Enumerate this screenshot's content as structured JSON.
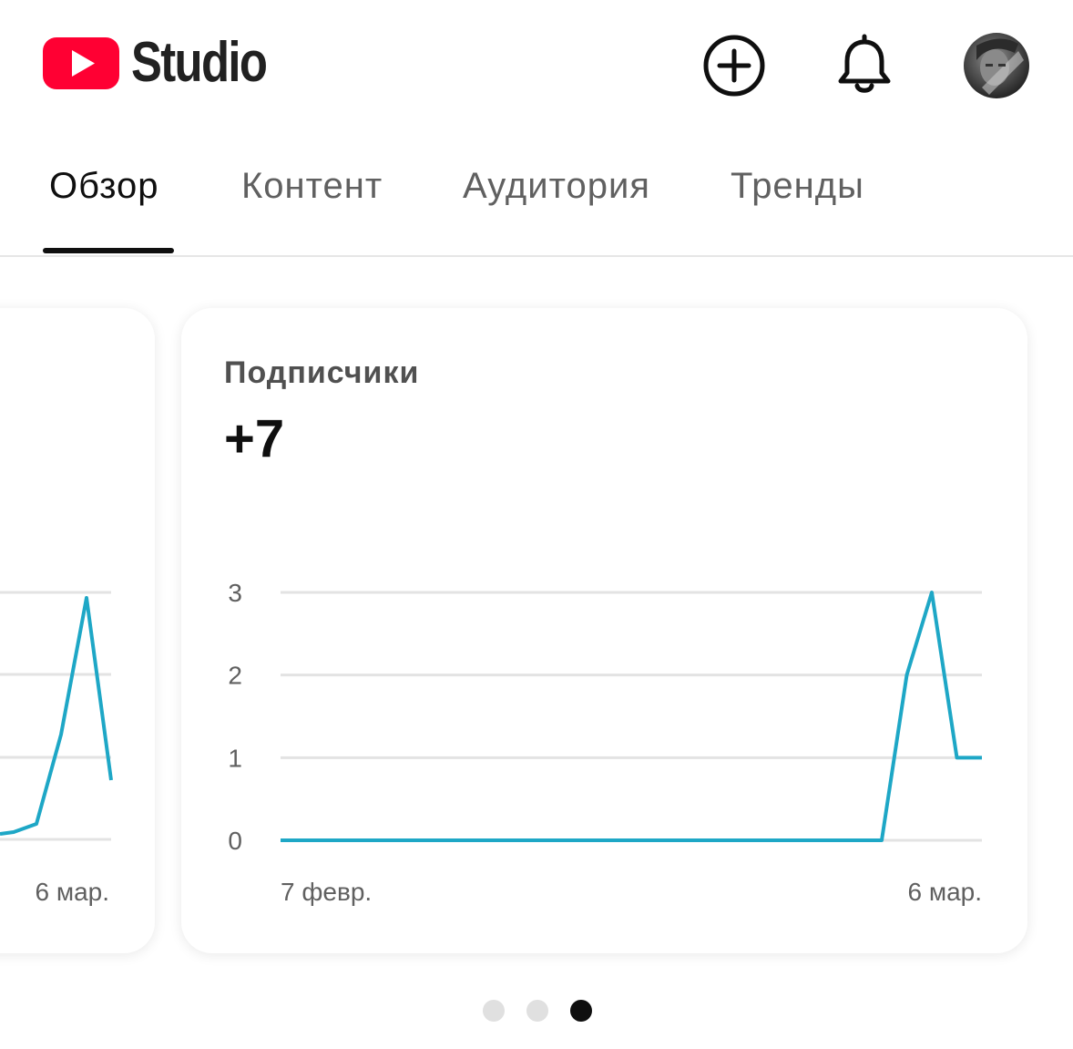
{
  "header": {
    "logo_text": "Studio",
    "icons": [
      "youtube-logo-icon",
      "add-circle-icon",
      "bell-icon",
      "avatar"
    ]
  },
  "tabs": [
    {
      "label": "Обзор",
      "active": true
    },
    {
      "label": "Контент",
      "active": false
    },
    {
      "label": "Аудитория",
      "active": false
    },
    {
      "label": "Тренды",
      "active": false
    }
  ],
  "cards": {
    "previous": {
      "x_label_end": "6 мар."
    },
    "subscribers": {
      "title": "Подписчики",
      "value": "+7"
    }
  },
  "chart_data": {
    "type": "line",
    "title": "Подписчики",
    "x": [
      "7 февр.",
      "",
      "",
      "",
      "",
      "",
      "",
      "",
      "",
      "",
      "",
      "",
      "",
      "",
      "",
      "",
      "",
      "",
      "",
      "",
      "",
      "",
      "",
      "",
      "",
      "",
      "",
      "",
      "6 мар."
    ],
    "x_tick_labels": [
      "7 февр.",
      "6 мар."
    ],
    "y_ticks": [
      0,
      1,
      2,
      3
    ],
    "ylim": [
      0,
      3
    ],
    "series": [
      {
        "values": [
          0,
          0,
          0,
          0,
          0,
          0,
          0,
          0,
          0,
          0,
          0,
          0,
          0,
          0,
          0,
          0,
          0,
          0,
          0,
          0,
          0,
          0,
          0,
          0,
          0,
          2,
          3,
          1,
          1
        ]
      }
    ],
    "line_color": "#1ea7c6",
    "grid": true
  },
  "pagination": {
    "count": 3,
    "active_index": 2
  },
  "colors": {
    "brand_red": "#ff0033",
    "accent_line": "#1ea7c6",
    "grid": "#e3e3e3"
  }
}
